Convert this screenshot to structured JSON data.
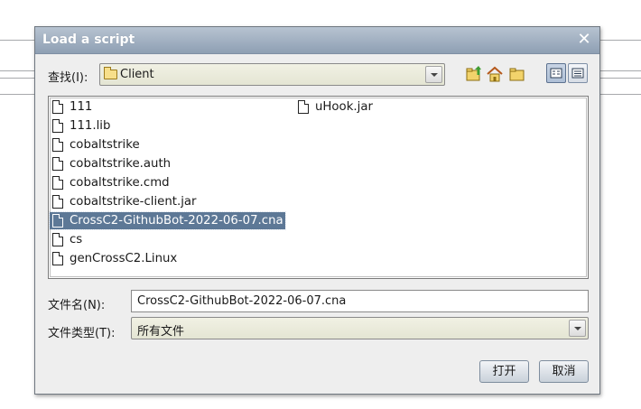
{
  "dialog": {
    "title": "Load a script",
    "close_glyph": "✕"
  },
  "look_in": {
    "label": "查找(I):",
    "value": "Client",
    "icon": "folder-icon"
  },
  "toolbar": {
    "icons": [
      "up-folder-icon",
      "home-icon",
      "new-folder-icon",
      "list-view-icon",
      "details-view-icon"
    ]
  },
  "files": [
    {
      "name": "111",
      "selected": false
    },
    {
      "name": "111.lib",
      "selected": false
    },
    {
      "name": "cobaltstrike",
      "selected": false
    },
    {
      "name": "cobaltstrike.auth",
      "selected": false
    },
    {
      "name": "cobaltstrike.cmd",
      "selected": false
    },
    {
      "name": "cobaltstrike-client.jar",
      "selected": false
    },
    {
      "name": "CrossC2-GithubBot-2022-06-07.cna",
      "selected": true
    },
    {
      "name": "cs",
      "selected": false
    },
    {
      "name": "genCrossC2.Linux",
      "selected": false
    },
    {
      "name": "uHook.jar",
      "selected": false
    }
  ],
  "file_name": {
    "label": "文件名(N):",
    "value": "CrossC2-GithubBot-2022-06-07.cna"
  },
  "file_type": {
    "label": "文件类型(T):",
    "value": "所有文件"
  },
  "buttons": {
    "open": "打开",
    "cancel": "取消"
  },
  "colors": {
    "titlebar": "#9aaabd",
    "selection": "#5d7896",
    "dialog_bg": "#eeeeee"
  }
}
